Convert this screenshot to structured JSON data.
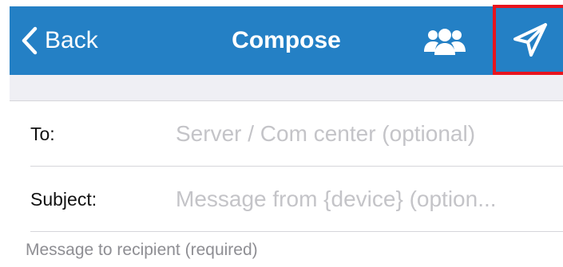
{
  "navbar": {
    "back_label": "Back",
    "title": "Compose",
    "bar_color": "#2480c5",
    "contacts_icon": "group-icon",
    "send_icon": "paper-plane-icon",
    "highlight_color": "#e8141e"
  },
  "form": {
    "to_label": "To:",
    "to_placeholder": "Server / Com center (optional)",
    "subject_label": "Subject:",
    "subject_placeholder": "Message from {device} (option..."
  },
  "message": {
    "placeholder": "Message to recipient (required)"
  }
}
